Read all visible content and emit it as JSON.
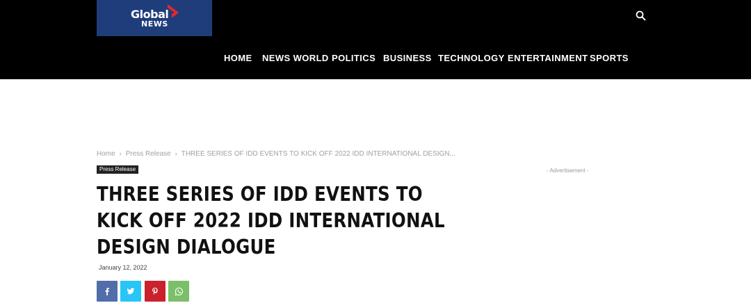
{
  "header": {
    "logo": {
      "word": "Global",
      "sub": "NEWS"
    },
    "nav": [
      {
        "label": "HOME"
      },
      {
        "label": "NEWS WORLD"
      },
      {
        "label": "POLITICS"
      },
      {
        "label": "BUSINESS"
      },
      {
        "label": "TECHNOLOGY"
      },
      {
        "label": "ENTERTAINMENT"
      },
      {
        "label": "SPORTS"
      }
    ],
    "search_icon": "search-icon"
  },
  "breadcrumb": {
    "items": [
      "Home",
      "Press Release",
      "THREE SERIES OF IDD EVENTS TO KICK OFF 2022 IDD INTERNATIONAL DESIGN..."
    ],
    "separator": "›"
  },
  "article": {
    "category": "Press Release",
    "title": "THREE SERIES OF IDD EVENTS TO KICK OFF 2022 IDD INTERNATIONAL DESIGN DIALOGUE",
    "date": "January 12, 2022"
  },
  "sidebar": {
    "ad_label": "- Advertisement -"
  },
  "share": [
    {
      "network": "facebook",
      "icon": "facebook-icon",
      "color": "#516eab"
    },
    {
      "network": "twitter",
      "icon": "twitter-icon",
      "color": "#29c5f6"
    },
    {
      "network": "pinterest",
      "icon": "pinterest-icon",
      "color": "#ca212a"
    },
    {
      "network": "whatsapp",
      "icon": "whatsapp-icon",
      "color": "#7bbf6a"
    }
  ],
  "colors": {
    "header_bg": "#000000",
    "logo_bg": "#1f3d7a",
    "logo_accent": "#e8262a"
  }
}
